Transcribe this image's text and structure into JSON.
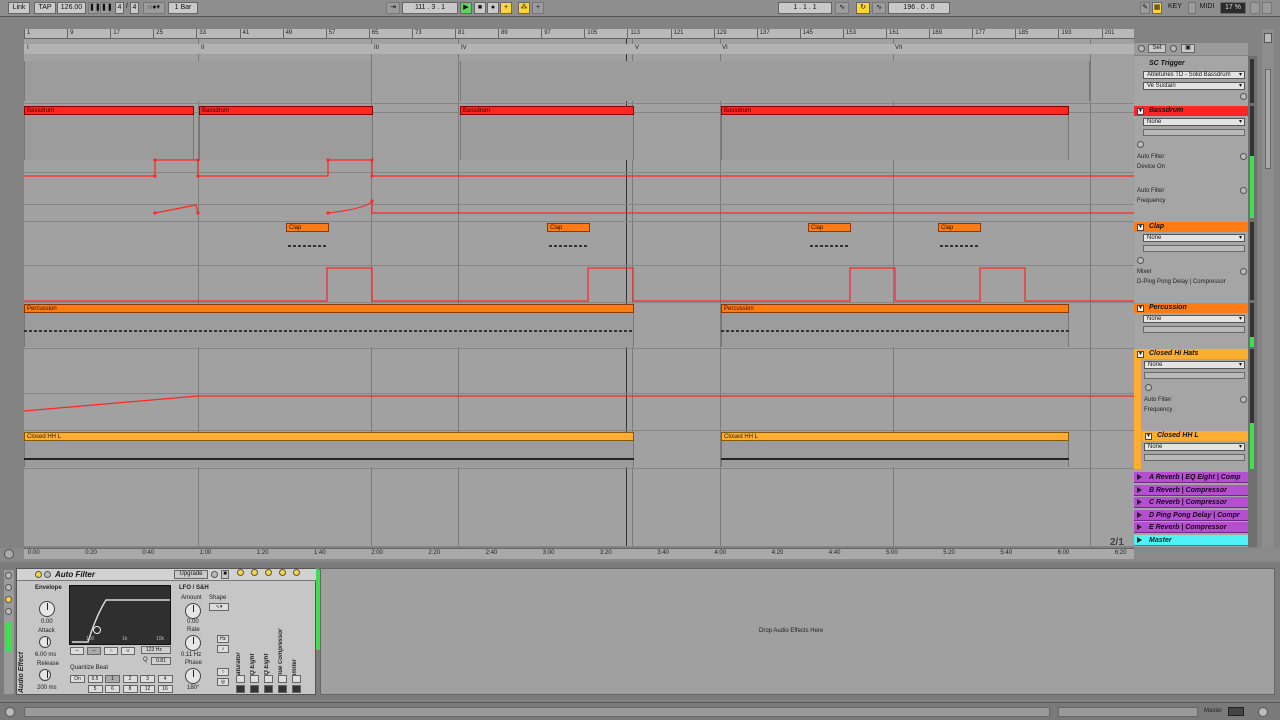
{
  "transport": {
    "link": "Link",
    "tap": "TAP",
    "tempo": "126.00",
    "sig_num": "4",
    "sig_den": "4",
    "quant": "1 Bar",
    "position": "111 . 3 . 1",
    "punch_start": "1 . 1 . 1",
    "loop_length": "196 . 0 . 0",
    "key": "KEY",
    "midi": "MIDI",
    "cpu": "17 %",
    "pos_sep": "/"
  },
  "ruler": {
    "bars": [
      "1",
      "9",
      "17",
      "25",
      "33",
      "41",
      "49",
      "57",
      "65",
      "73",
      "81",
      "89",
      "97",
      "105",
      "113",
      "121",
      "129",
      "137",
      "145",
      "153",
      "161",
      "169",
      "177",
      "185",
      "193",
      "201"
    ]
  },
  "locators": [
    "I",
    "II",
    "III",
    "IV",
    "V",
    "VI",
    "VII"
  ],
  "timeline": [
    "0:00",
    "0:20",
    "0:40",
    "1:00",
    "1:20",
    "1:40",
    "2:00",
    "2:20",
    "2:40",
    "3:00",
    "3:20",
    "3:40",
    "4:00",
    "4:20",
    "4:40",
    "5:00",
    "5:20",
    "5:40",
    "6:00",
    "6:20"
  ],
  "page_indicator": "2/1",
  "clips": {
    "bassdrum": "Bassdrum",
    "clap": "Clap",
    "percussion": "Percussion",
    "hats": "Closed HH L"
  },
  "panel": {
    "set_button": "Set",
    "sc_trigger": "SC Trigger",
    "sc_input": "Abletunes TD - Solid Bassdrum",
    "sc_post": "Ve Sustain",
    "bassdrum": "Bassdrum",
    "none": "None",
    "auto_filter": "Auto Filter",
    "device_on": "Device On",
    "frequency": "Frequency",
    "clap": "Clap",
    "mixer": "Mixer",
    "clap_chain": "D-Ping Pong Delay | Compressor",
    "percussion": "Percussion",
    "closed_hi_hats": "Closed Hi Hats",
    "closed_hh_l": "Closed HH L",
    "returns": [
      "A Reverb | EQ Eight | Comp",
      "B Reverb | Compressor",
      "C Reverb | Compressor",
      "D Ping Pong Delay | Compr",
      "E Reverb | Compressor"
    ],
    "master": "Master"
  },
  "device": {
    "title": "Auto Filter",
    "upgrade": "Upgrade",
    "side_label": "Audio Effect",
    "envelope": "Envelope",
    "env_val": "0.00",
    "attack": "Attack",
    "attack_val": "6.00 ms",
    "release": "Release",
    "release_val": "200 ms",
    "freq_labels": [
      "100",
      "1k",
      "10k"
    ],
    "freq": "123 Hz",
    "q_label": "Q",
    "q_val": "0.81",
    "quantize": "Quantize Beat",
    "quant_buttons": [
      "On",
      "0.5",
      "1",
      "2",
      "3",
      "4",
      "5",
      "6",
      "8",
      "12",
      "16"
    ],
    "lfo": "LFO / S&H",
    "amount": "Amount",
    "amount_val": "0.00",
    "shape": "Shape",
    "rate": "Rate",
    "rate_val": "0.11 Hz",
    "hz": "Hz",
    "phase": "Phase",
    "phase_val": "180°",
    "chain": [
      "Saturator",
      "EQ Eight",
      "EQ Eight",
      "Glue Compressor",
      "Limiter"
    ],
    "drop_text": "Drop Audio Effects Here"
  },
  "status": {
    "master": "Master"
  },
  "colors": {
    "red": "#ff2626",
    "orange": "#ff7b14",
    "yellow": "#ffad33",
    "purple": "#b44fd0",
    "cyan": "#4ff3f7",
    "meter": "#3fe04f"
  }
}
